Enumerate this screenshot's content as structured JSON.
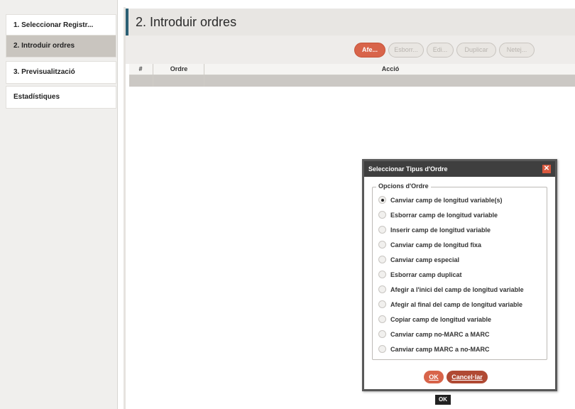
{
  "sidebar": {
    "items": [
      {
        "label": "1. Seleccionar Registr..."
      },
      {
        "label": "2. Introduir ordres"
      },
      {
        "label": "3. Previsualització"
      },
      {
        "label": "Estadístiques"
      }
    ]
  },
  "header": {
    "title": "2. Introduir ordres"
  },
  "toolbar": {
    "buttons": [
      {
        "label": "Afe..."
      },
      {
        "label": "Esborr..."
      },
      {
        "label": "Edi..."
      },
      {
        "label": "Duplicar"
      },
      {
        "label": "Netej..."
      }
    ]
  },
  "table": {
    "columns": [
      "#",
      "Ordre",
      "Acció"
    ],
    "rows": [
      [
        "",
        "",
        ""
      ]
    ]
  },
  "dialog": {
    "title": "Seleccionar Tipus d'Ordre",
    "close_glyph": "✕",
    "group_label": "Opcions d'Ordre",
    "options": [
      {
        "label": "Canviar camp de longitud variable(s)",
        "selected": true
      },
      {
        "label": "Esborrar camp de longitud variable",
        "selected": false
      },
      {
        "label": "Inserir camp de longitud variable",
        "selected": false
      },
      {
        "label": "Canviar camp de longitud fixa",
        "selected": false
      },
      {
        "label": "Canviar camp especial",
        "selected": false
      },
      {
        "label": "Esborrar camp duplicat",
        "selected": false
      },
      {
        "label": "Afegir a l'inici del camp de longitud variable",
        "selected": false
      },
      {
        "label": "Afegir al final del camp de longitud variable",
        "selected": false
      },
      {
        "label": "Copiar camp de longitud variable",
        "selected": false
      },
      {
        "label": "Canviar camp no-MARC a MARC",
        "selected": false
      },
      {
        "label": "Canviar camp MARC a no-MARC",
        "selected": false
      }
    ],
    "ok_label": "OK",
    "cancel_label": "Cancel·lar"
  },
  "tooltip": {
    "text": "OK"
  },
  "colors": {
    "accent": "#d8644a",
    "header_bar": "#2b5f74",
    "dialog_title_bg": "#3f3f3f"
  }
}
